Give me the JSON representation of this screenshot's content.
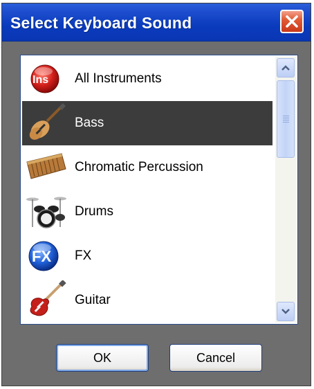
{
  "window": {
    "title": "Select Keyboard Sound"
  },
  "list": {
    "items": [
      {
        "label": "All Instruments",
        "icon": "ins-logo-icon",
        "selected": false
      },
      {
        "label": "Bass",
        "icon": "bass-guitar-icon",
        "selected": true
      },
      {
        "label": "Chromatic Percussion",
        "icon": "xylophone-icon",
        "selected": false
      },
      {
        "label": "Drums",
        "icon": "drum-kit-icon",
        "selected": false
      },
      {
        "label": "FX",
        "icon": "fx-logo-icon",
        "selected": false
      },
      {
        "label": "Guitar",
        "icon": "electric-guitar-icon",
        "selected": false
      }
    ]
  },
  "buttons": {
    "ok": "OK",
    "cancel": "Cancel"
  },
  "colors": {
    "titlebar": "#0a3bbd",
    "selection": "#3c3c3c",
    "frame": "#6e6e6e"
  }
}
